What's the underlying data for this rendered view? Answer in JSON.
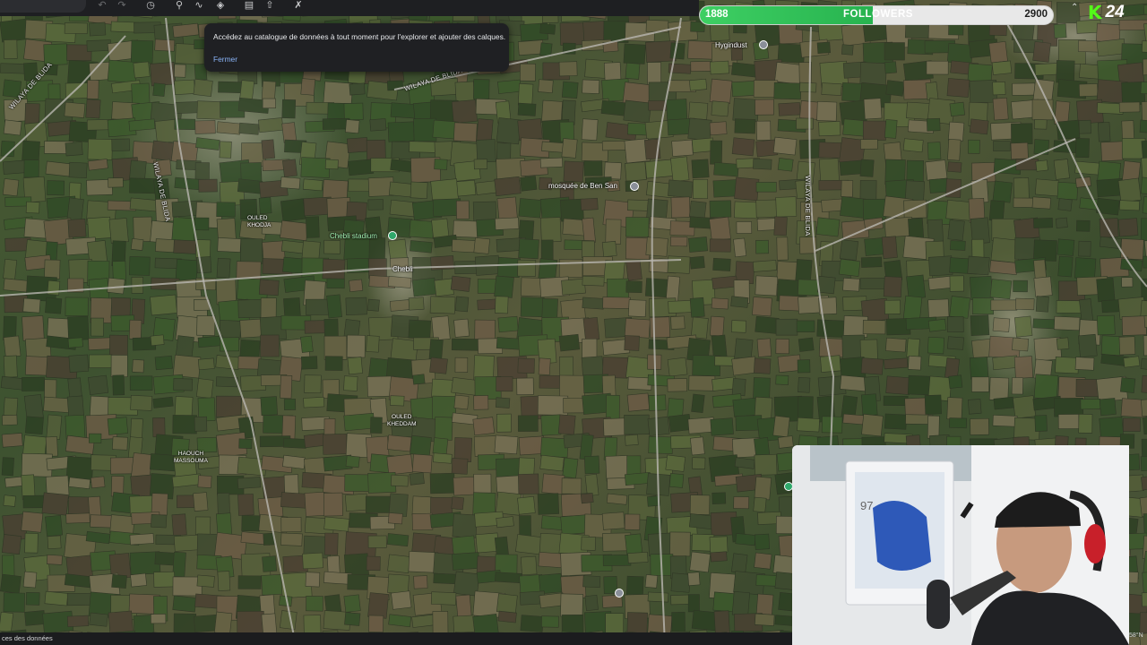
{
  "tooltip": {
    "message": "Accédez au catalogue de données à tout moment pour l'explorer et ajouter des calques.",
    "close_label": "Fermer"
  },
  "map": {
    "places": [
      {
        "name": "Hygindust",
        "pin": "gray"
      },
      {
        "name": "mosquée de Ben San",
        "pin": "gray"
      },
      {
        "name": "Chebli stadium",
        "pin": "green"
      },
      {
        "name": "Chebli"
      },
      {
        "name": "OULED\nKHODJA"
      },
      {
        "name": "OULED\nKHEDDAM"
      },
      {
        "name": "HAOUCH\nMASSOUMA"
      }
    ],
    "roads": [
      "WILAYA DE BLIDA",
      "WILAYA DE BLIDA",
      "WILAYA DE BLIDA",
      "WILAYA DE BLIDA"
    ]
  },
  "overlay": {
    "followers": {
      "label": "FOLLOWERS",
      "current": "1888",
      "goal": "2900",
      "progress": 0.49
    },
    "brand": {
      "logo": "K",
      "number": "24"
    }
  },
  "status": {
    "data_sources": "ces des données",
    "coords": "58°N"
  },
  "colors": {
    "follow_green": "#3ecf63",
    "kick_green": "#53fc18",
    "link_blue": "#8ab4f8"
  }
}
